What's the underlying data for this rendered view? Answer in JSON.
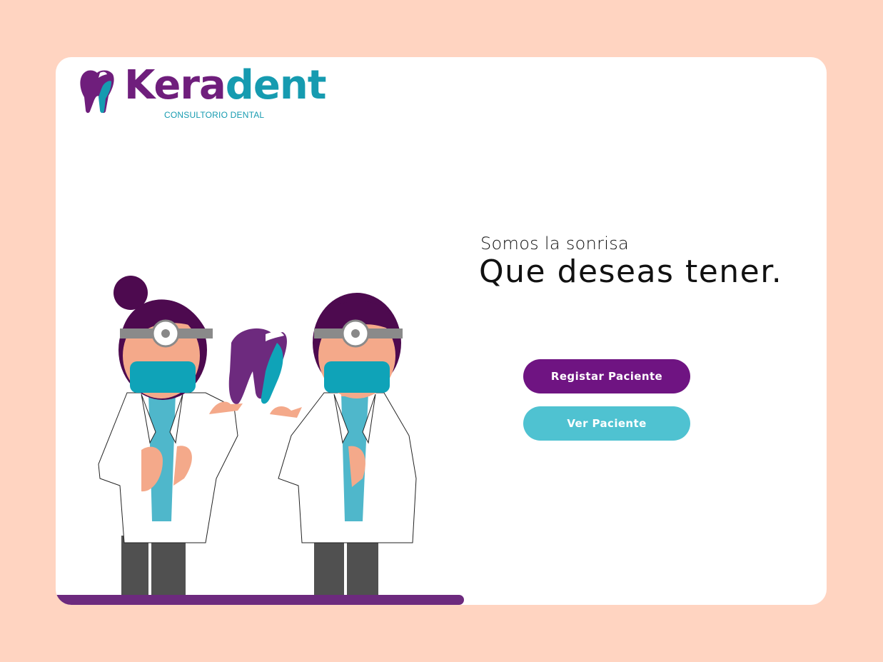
{
  "brand": {
    "name_part1": "Kera",
    "name_part2": "dent",
    "subtitle": "CONSULTORIO DENTAL",
    "colors": {
      "purple": "#6F1E7C",
      "teal": "#169BB0"
    }
  },
  "hero": {
    "tagline": "Somos la sonrisa",
    "headline": "Que deseas tener."
  },
  "actions": {
    "register_label": "Registar Paciente",
    "view_label": "Ver Paciente"
  },
  "icons": [
    "tooth-logo-icon"
  ],
  "colors": {
    "background": "#FFD4C1",
    "card": "#FFFFFF",
    "button_primary": "#6F1482",
    "button_secondary": "#4FC2D1",
    "floor": "#6D2A7E"
  }
}
